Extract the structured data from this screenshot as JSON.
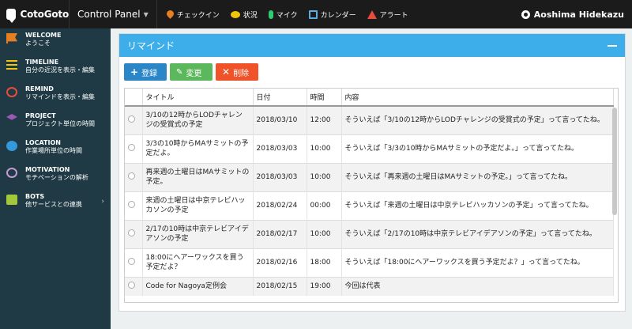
{
  "topbar": {
    "brand": "CotoGoto",
    "control_panel": "Control Panel",
    "nav": [
      {
        "label": "チェックイン",
        "icon": "pin-icon"
      },
      {
        "label": "状況",
        "icon": "speech-bubble-icon"
      },
      {
        "label": "マイク",
        "icon": "mic-icon"
      },
      {
        "label": "カレンダー",
        "icon": "calendar-icon"
      },
      {
        "label": "アラート",
        "icon": "alert-icon"
      }
    ],
    "user": "Aoshima Hidekazu"
  },
  "sidebar": {
    "items": [
      {
        "title": "WELCOME",
        "sub": "ようこそ",
        "icon": "flag-icon"
      },
      {
        "title": "TIMELINE",
        "sub": "自分の近況を表示・編集",
        "icon": "list-icon"
      },
      {
        "title": "REMIND",
        "sub": "リマインドを表示・編集",
        "icon": "alarm-clock-icon"
      },
      {
        "title": "PROJECT",
        "sub": "プロジェクト単位の時間",
        "icon": "layers-icon"
      },
      {
        "title": "LOCATION",
        "sub": "作業場所単位の時間",
        "icon": "globe-icon"
      },
      {
        "title": "MOTIVATION",
        "sub": "モチベーションの解析",
        "icon": "smile-icon"
      },
      {
        "title": "BOTS",
        "sub": "他サービスとの連携",
        "icon": "bot-icon"
      }
    ]
  },
  "panel": {
    "title": "リマインド",
    "buttons": {
      "add": "登録",
      "edit": "変更",
      "delete": "削除"
    },
    "columns": [
      "タイトル",
      "日付",
      "時間",
      "内容"
    ],
    "rows": [
      {
        "title": "3/10の12時からLODチャレンジの受賞式の予定",
        "date": "2018/03/10",
        "time": "12:00",
        "content": "そういえば「3/10の12時からLODチャレンジの受賞式の予定」って言ってたね。"
      },
      {
        "title": "3/3の10時からMAサミットの予定だよ。",
        "date": "2018/03/03",
        "time": "10:00",
        "content": "そういえば「3/3の10時からMAサミットの予定だよ。」って言ってたね。"
      },
      {
        "title": "再来週の土曜日はMAサミットの予定。",
        "date": "2018/03/03",
        "time": "10:00",
        "content": "そういえば「再来週の土曜日はMAサミットの予定。」って言ってたね。"
      },
      {
        "title": "来週の土曜日は中京テレビハッカソンの予定",
        "date": "2018/02/24",
        "time": "00:00",
        "content": "そういえば「来週の土曜日は中京テレビハッカソンの予定」って言ってたね。"
      },
      {
        "title": "2/17の10時は中京テレビアイデアソンの予定",
        "date": "2018/02/17",
        "time": "10:00",
        "content": "そういえば「2/17の10時は中京テレビアイデアソンの予定」って言ってたね。"
      },
      {
        "title": "18:00にヘアーワックスを買う予定だよ？",
        "date": "2018/02/16",
        "time": "18:00",
        "content": "そういえば「18:00にヘアーワックスを買う予定だよ？」って言ってたね。"
      },
      {
        "title": "Code for Nagoya定例会",
        "date": "2018/02/15",
        "time": "19:00",
        "content": "今回は代表"
      }
    ]
  }
}
